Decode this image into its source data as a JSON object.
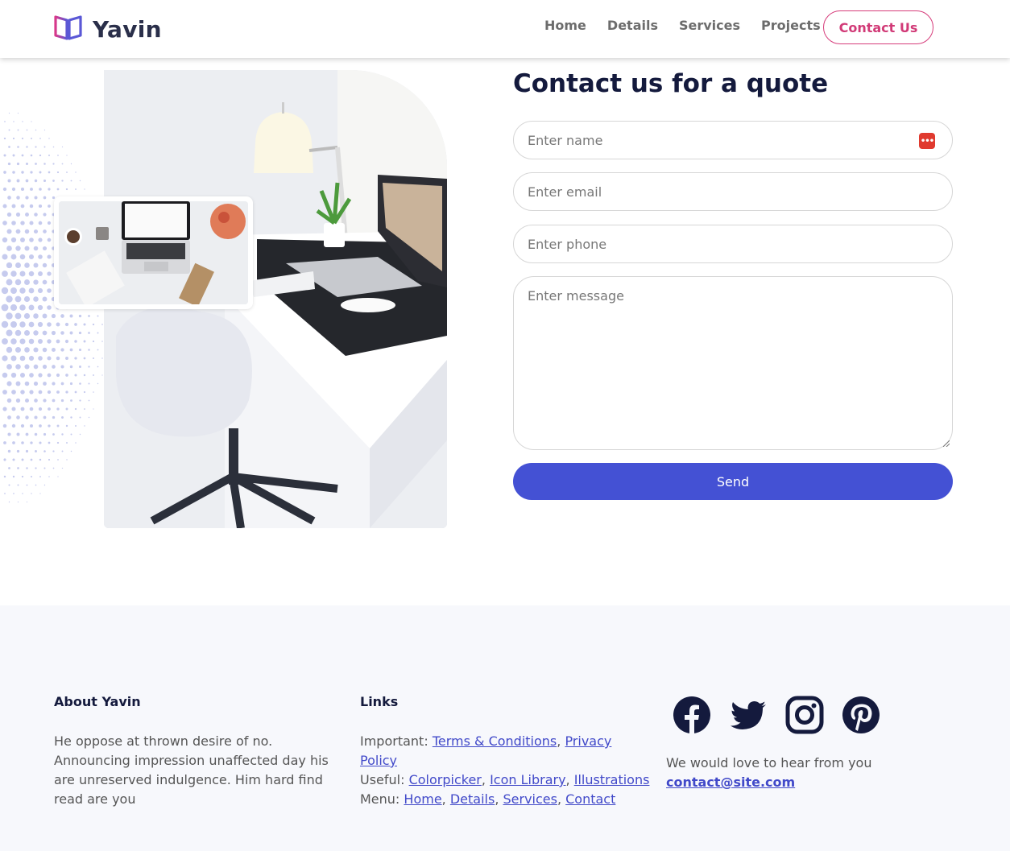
{
  "header": {
    "brand": "Yavin",
    "nav": [
      "Home",
      "Details",
      "Services",
      "Projects"
    ],
    "cta": "Contact Us"
  },
  "form": {
    "title": "Contact us for a quote",
    "name_placeholder": "Enter name",
    "email_placeholder": "Enter email",
    "phone_placeholder": "Enter phone",
    "message_placeholder": "Enter message",
    "send": "Send"
  },
  "footer": {
    "about_title": "About Yavin",
    "about_text": "He oppose at thrown desire of no. Announcing impression unaffected day his are unreserved indulgence. Him hard find read are you",
    "links_title": "Links",
    "important_label": "Important:",
    "important_links": [
      "Terms & Conditions",
      "Privacy Policy"
    ],
    "useful_label": "Useful:",
    "useful_links": [
      "Colorpicker",
      "Icon Library",
      "Illustrations"
    ],
    "menu_label": "Menu:",
    "menu_links": [
      "Home",
      "Details",
      "Services",
      "Contact"
    ],
    "social_icons": [
      "facebook-icon",
      "twitter-icon",
      "instagram-icon",
      "pinterest-icon"
    ],
    "love_text": "We would love to hear from you",
    "email": "contact@site.com"
  },
  "colors": {
    "accent": "#4451d4",
    "cta": "#d13a77",
    "heading": "#141a3d"
  }
}
